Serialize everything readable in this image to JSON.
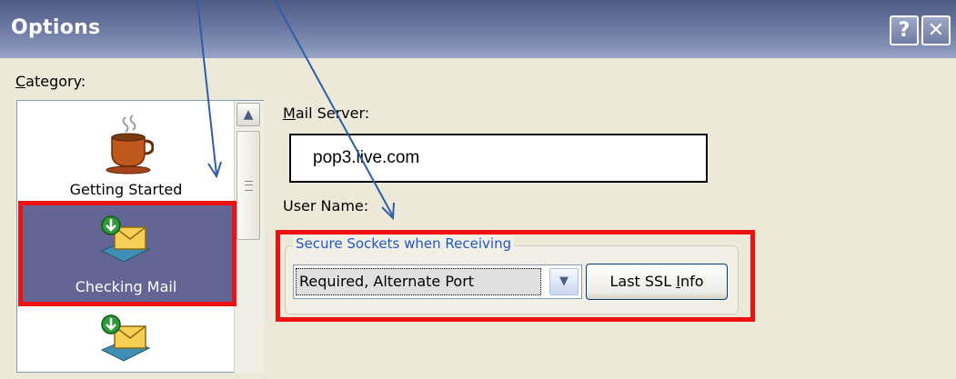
{
  "window": {
    "title": "Options",
    "help_label": "?",
    "close_label": "✕"
  },
  "category": {
    "label_accesskey": "C",
    "label_rest": "ategory:",
    "items": [
      {
        "label": "Getting Started",
        "icon": "coffee-cup-icon"
      },
      {
        "label": "Checking Mail",
        "icon": "mail-download-icon",
        "selected": true
      },
      {
        "label": "",
        "icon": "mail-download-icon"
      }
    ],
    "scroll_up": "▲"
  },
  "mail_server": {
    "label_accesskey": "M",
    "label_rest": "ail Server:",
    "value": "pop3.live.com"
  },
  "user_name": {
    "label": "User Name:"
  },
  "secure_sockets": {
    "legend": "Secure Sockets when Receiving",
    "selected_option": "Required, Alternate Port",
    "dropdown_arrow": "▼",
    "button_label_pre": "Last SSL ",
    "button_label_accesskey": "I",
    "button_label_post": "nfo"
  },
  "colors": {
    "titlebar": "#5f6b94",
    "selection": "#636594",
    "highlight_box": "#ee1111",
    "annotation_arrow": "#2e5fa8",
    "legend_text": "#1f57c8"
  }
}
